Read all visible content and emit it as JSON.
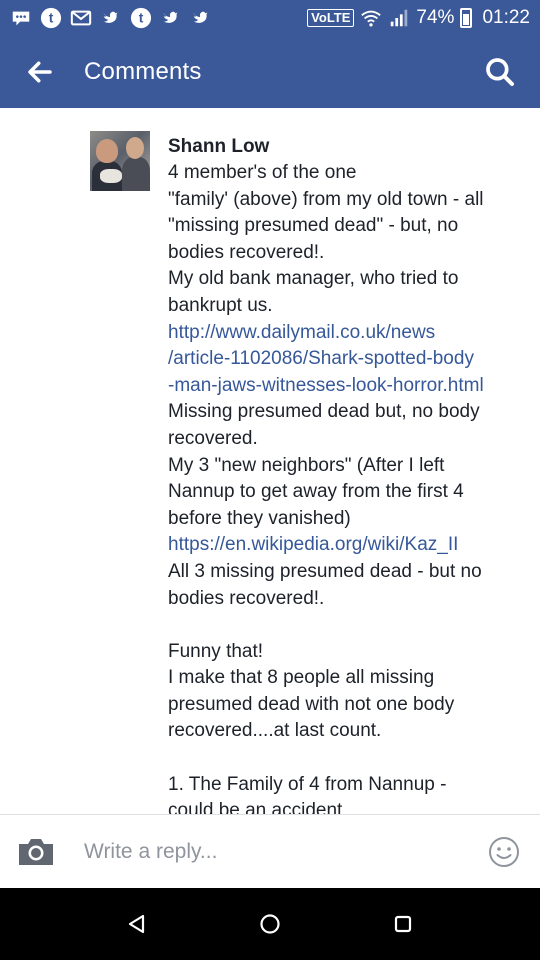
{
  "status_bar": {
    "left_icons": [
      "messenger-icon",
      "tumblr-icon",
      "gmail-icon",
      "bird-icon",
      "tumblr-icon",
      "bird-icon",
      "bird-icon"
    ],
    "network": "VoLTE",
    "battery": "74%",
    "time": "01:22"
  },
  "app_bar": {
    "title": "Comments"
  },
  "comment": {
    "author": "Shann Low",
    "lines": [
      {
        "text": "4 member's of the one",
        "type": "text"
      },
      {
        "text": "\"family' (above) from my old town - all",
        "type": "text"
      },
      {
        "text": "\"missing presumed dead\" - but, no",
        "type": "text"
      },
      {
        "text": "bodies recovered!.",
        "type": "text"
      },
      {
        "text": "My old bank manager, who tried to",
        "type": "text"
      },
      {
        "text": "bankrupt us.",
        "type": "text"
      },
      {
        "text": "http://www.dailymail.co.uk/news",
        "type": "link"
      },
      {
        "text": "/article-1102086/Shark-spotted-body",
        "type": "link"
      },
      {
        "text": "-man-jaws-witnesses-look-horror.html",
        "type": "link"
      },
      {
        "text": "Missing presumed dead but, no body",
        "type": "text"
      },
      {
        "text": "recovered.",
        "type": "text"
      },
      {
        "text": "My 3 \"new neighbors\" (After I left",
        "type": "text"
      },
      {
        "text": "Nannup to get away from the first 4",
        "type": "text"
      },
      {
        "text": "before they vanished)",
        "type": "text"
      },
      {
        "text": "https://en.wikipedia.org/wiki/Kaz_II",
        "type": "link"
      },
      {
        "text": "All 3 missing presumed dead - but no",
        "type": "text"
      },
      {
        "text": "bodies recovered!.",
        "type": "text"
      },
      {
        "text": "",
        "type": "blank"
      },
      {
        "text": "Funny that!",
        "type": "text"
      },
      {
        "text": "I make that 8 people all missing",
        "type": "text"
      },
      {
        "text": "presumed dead with not one body",
        "type": "text"
      },
      {
        "text": "recovered....at last count.",
        "type": "text"
      },
      {
        "text": "",
        "type": "blank"
      },
      {
        "text": "1. The Family of 4 from Nannup -",
        "type": "text"
      },
      {
        "text": "could be an accident",
        "type": "text"
      }
    ]
  },
  "reply_bar": {
    "placeholder": "Write a reply..."
  },
  "colors": {
    "brand": "#3b5998",
    "link": "#365899",
    "text": "#1d2129"
  }
}
